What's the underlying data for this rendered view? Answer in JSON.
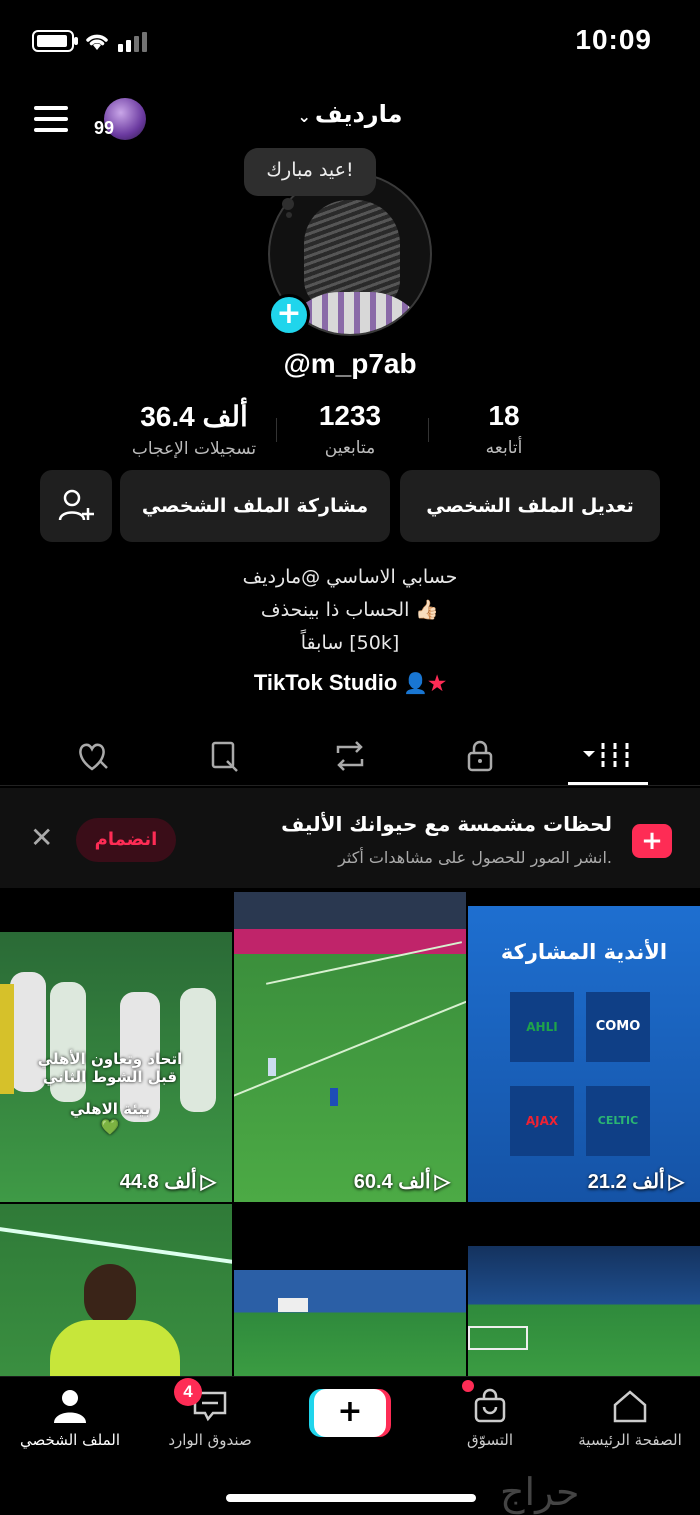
{
  "status_bar": {
    "time": "10:09"
  },
  "header": {
    "account_name": "ماردیف",
    "avatar_badge": "99"
  },
  "profile": {
    "bubble_note": "عيد مبارك!",
    "username": "@m_p7ab",
    "stats": [
      {
        "value": "18",
        "label": "أتابعه"
      },
      {
        "value": "1233",
        "label": "متابعين"
      },
      {
        "value": "36.4 ألف",
        "label": "تسجيلات الإعجاب"
      }
    ],
    "buttons": {
      "edit": "تعديل الملف الشخصي",
      "share": "مشاركة الملف الشخصي"
    },
    "bio": [
      "حسابي الاساسي @ماردیف",
      "الحساب ذا بينحذف 👍🏻",
      "سابقاً [50k]"
    ],
    "studio": "TikTok Studio"
  },
  "promo": {
    "title": "لحظات مشمسة مع حيوانك الأليف",
    "subtitle": "انشر الصور للحصول على مشاهدات أكثر.",
    "join": "انضمام"
  },
  "videos": [
    {
      "views": "21.2 ألف",
      "caption": "الأندية المشاركة",
      "tags": [
        "COMO",
        "AHLI",
        "CELTIC",
        "AJAX"
      ]
    },
    {
      "views": "60.4 ألف"
    },
    {
      "views": "44.8 ألف",
      "caption": "اتحاد وتعاون الأهلي قبل الشوط الثاني",
      "caption2": "بيئة الاهلي 💚"
    },
    {},
    {},
    {}
  ],
  "nav": {
    "home": "الصفحة الرئيسية",
    "shop": "التسوّق",
    "inbox": "صندوق الوارد",
    "inbox_count": "4",
    "profile": "الملف الشخصي"
  },
  "watermark": "حراج"
}
